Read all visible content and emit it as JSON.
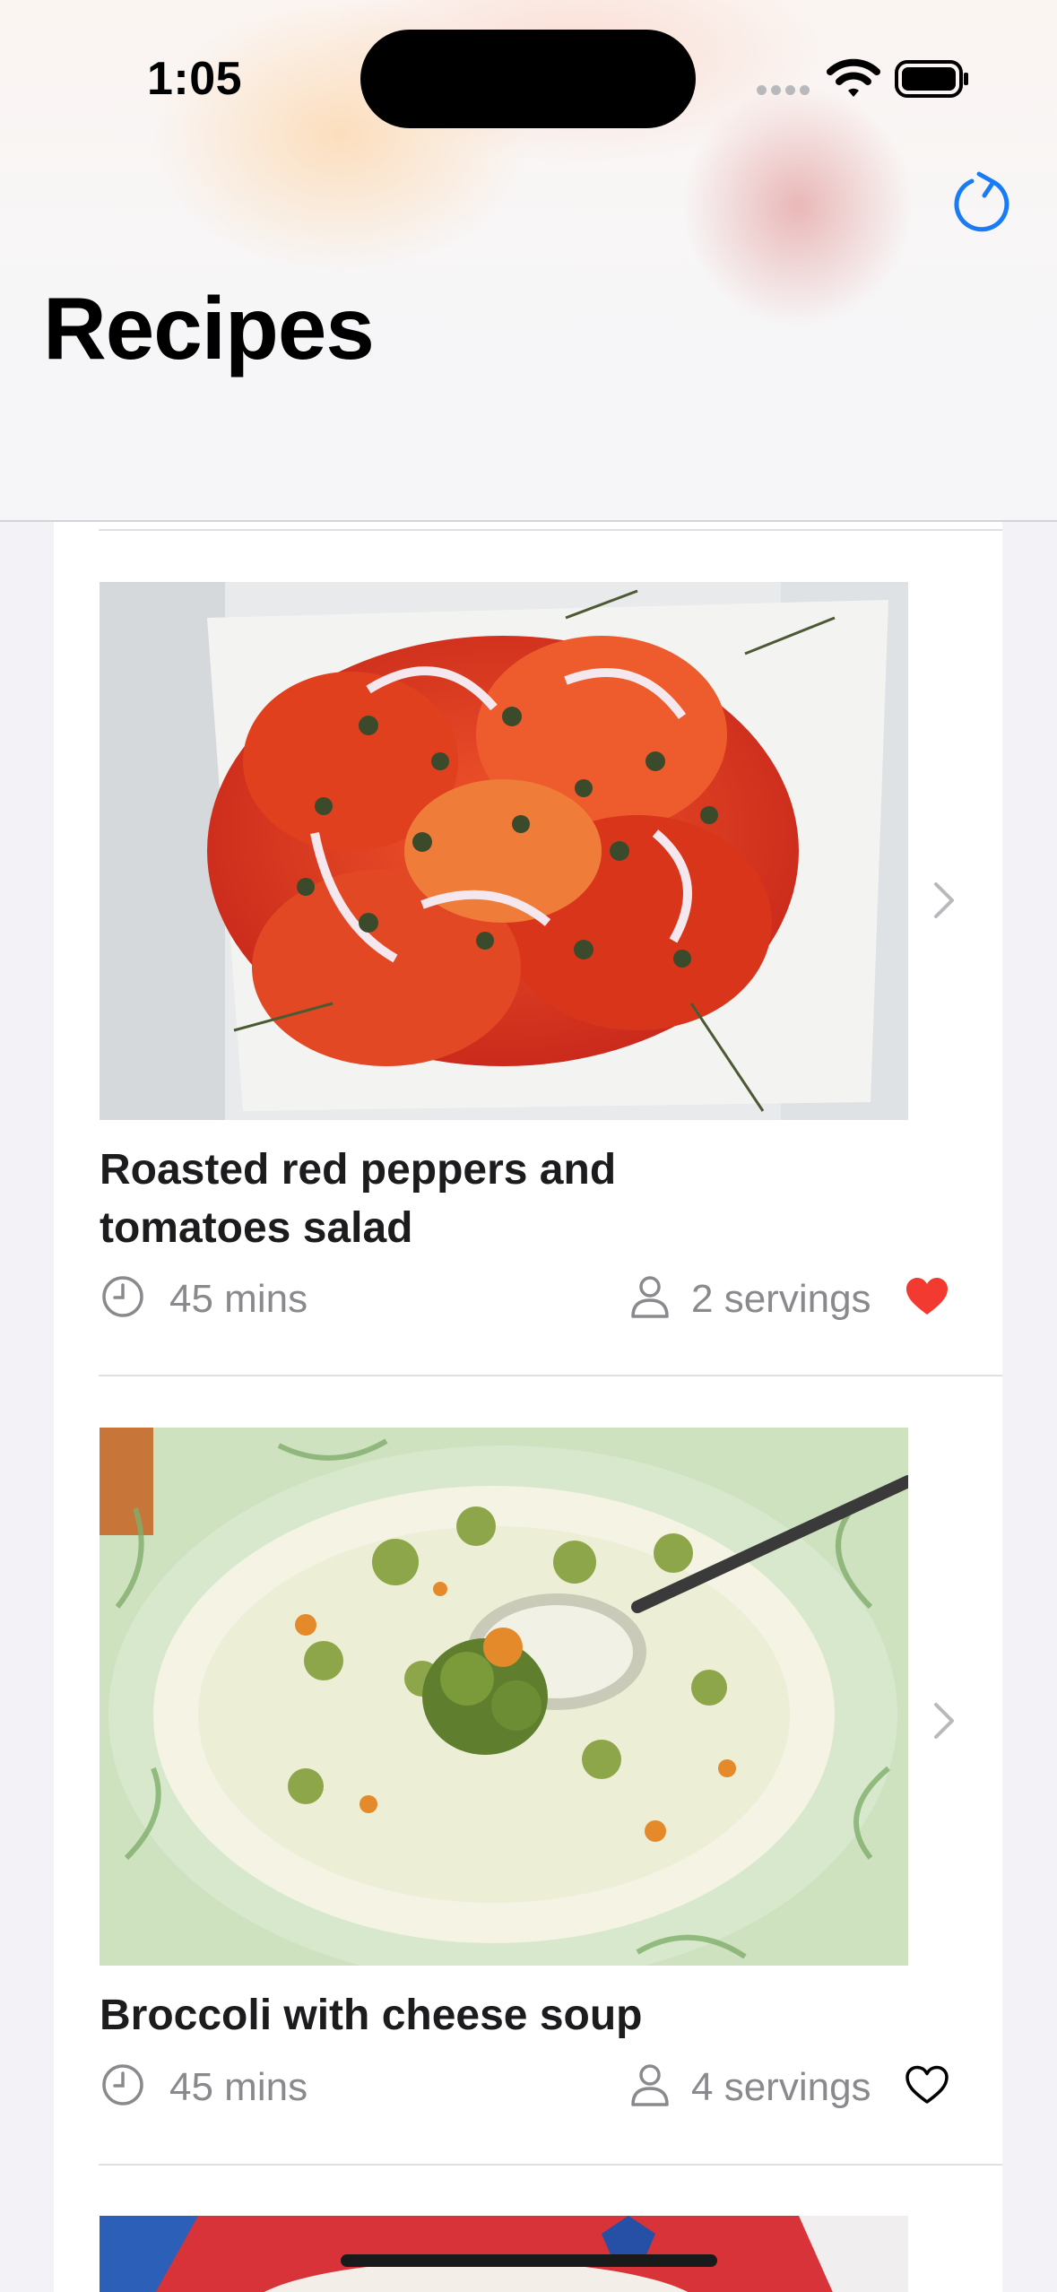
{
  "status_bar": {
    "time": "1:05"
  },
  "nav": {
    "title": "Recipes",
    "refresh_icon": "arrow-clockwise-icon",
    "accent": "#1a7cf5"
  },
  "recipes": [
    {
      "title": "Roasted red peppers and tomatoes salad",
      "time": "45 mins",
      "servings": "2 servings",
      "favorite": true,
      "heart_color": "#f23a30"
    },
    {
      "title": "Broccoli with cheese soup",
      "time": "45 mins",
      "servings": "4 servings",
      "favorite": false,
      "heart_color": "#000000"
    }
  ]
}
